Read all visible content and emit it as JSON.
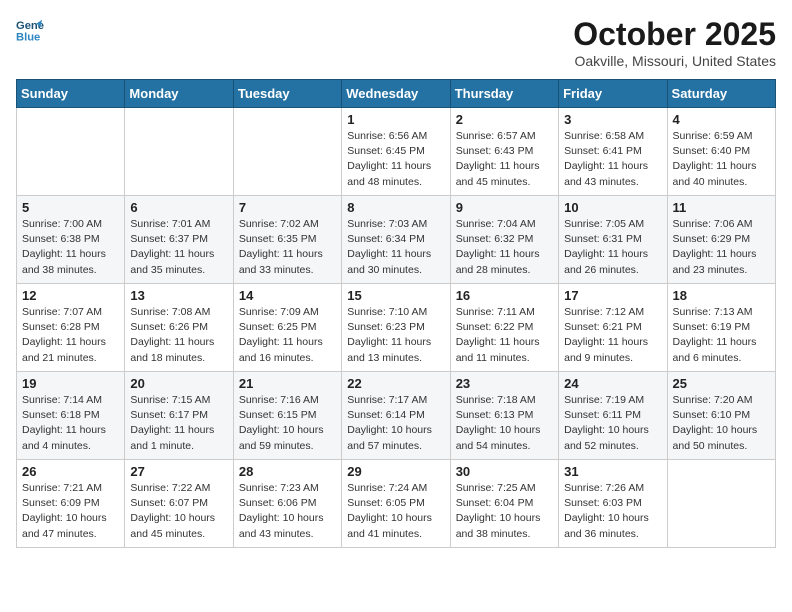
{
  "header": {
    "logo_line1": "General",
    "logo_line2": "Blue",
    "title": "October 2025",
    "subtitle": "Oakville, Missouri, United States"
  },
  "weekdays": [
    "Sunday",
    "Monday",
    "Tuesday",
    "Wednesday",
    "Thursday",
    "Friday",
    "Saturday"
  ],
  "weeks": [
    [
      {
        "day": "",
        "info": ""
      },
      {
        "day": "",
        "info": ""
      },
      {
        "day": "",
        "info": ""
      },
      {
        "day": "1",
        "info": "Sunrise: 6:56 AM\nSunset: 6:45 PM\nDaylight: 11 hours and 48 minutes."
      },
      {
        "day": "2",
        "info": "Sunrise: 6:57 AM\nSunset: 6:43 PM\nDaylight: 11 hours and 45 minutes."
      },
      {
        "day": "3",
        "info": "Sunrise: 6:58 AM\nSunset: 6:41 PM\nDaylight: 11 hours and 43 minutes."
      },
      {
        "day": "4",
        "info": "Sunrise: 6:59 AM\nSunset: 6:40 PM\nDaylight: 11 hours and 40 minutes."
      }
    ],
    [
      {
        "day": "5",
        "info": "Sunrise: 7:00 AM\nSunset: 6:38 PM\nDaylight: 11 hours and 38 minutes."
      },
      {
        "day": "6",
        "info": "Sunrise: 7:01 AM\nSunset: 6:37 PM\nDaylight: 11 hours and 35 minutes."
      },
      {
        "day": "7",
        "info": "Sunrise: 7:02 AM\nSunset: 6:35 PM\nDaylight: 11 hours and 33 minutes."
      },
      {
        "day": "8",
        "info": "Sunrise: 7:03 AM\nSunset: 6:34 PM\nDaylight: 11 hours and 30 minutes."
      },
      {
        "day": "9",
        "info": "Sunrise: 7:04 AM\nSunset: 6:32 PM\nDaylight: 11 hours and 28 minutes."
      },
      {
        "day": "10",
        "info": "Sunrise: 7:05 AM\nSunset: 6:31 PM\nDaylight: 11 hours and 26 minutes."
      },
      {
        "day": "11",
        "info": "Sunrise: 7:06 AM\nSunset: 6:29 PM\nDaylight: 11 hours and 23 minutes."
      }
    ],
    [
      {
        "day": "12",
        "info": "Sunrise: 7:07 AM\nSunset: 6:28 PM\nDaylight: 11 hours and 21 minutes."
      },
      {
        "day": "13",
        "info": "Sunrise: 7:08 AM\nSunset: 6:26 PM\nDaylight: 11 hours and 18 minutes."
      },
      {
        "day": "14",
        "info": "Sunrise: 7:09 AM\nSunset: 6:25 PM\nDaylight: 11 hours and 16 minutes."
      },
      {
        "day": "15",
        "info": "Sunrise: 7:10 AM\nSunset: 6:23 PM\nDaylight: 11 hours and 13 minutes."
      },
      {
        "day": "16",
        "info": "Sunrise: 7:11 AM\nSunset: 6:22 PM\nDaylight: 11 hours and 11 minutes."
      },
      {
        "day": "17",
        "info": "Sunrise: 7:12 AM\nSunset: 6:21 PM\nDaylight: 11 hours and 9 minutes."
      },
      {
        "day": "18",
        "info": "Sunrise: 7:13 AM\nSunset: 6:19 PM\nDaylight: 11 hours and 6 minutes."
      }
    ],
    [
      {
        "day": "19",
        "info": "Sunrise: 7:14 AM\nSunset: 6:18 PM\nDaylight: 11 hours and 4 minutes."
      },
      {
        "day": "20",
        "info": "Sunrise: 7:15 AM\nSunset: 6:17 PM\nDaylight: 11 hours and 1 minute."
      },
      {
        "day": "21",
        "info": "Sunrise: 7:16 AM\nSunset: 6:15 PM\nDaylight: 10 hours and 59 minutes."
      },
      {
        "day": "22",
        "info": "Sunrise: 7:17 AM\nSunset: 6:14 PM\nDaylight: 10 hours and 57 minutes."
      },
      {
        "day": "23",
        "info": "Sunrise: 7:18 AM\nSunset: 6:13 PM\nDaylight: 10 hours and 54 minutes."
      },
      {
        "day": "24",
        "info": "Sunrise: 7:19 AM\nSunset: 6:11 PM\nDaylight: 10 hours and 52 minutes."
      },
      {
        "day": "25",
        "info": "Sunrise: 7:20 AM\nSunset: 6:10 PM\nDaylight: 10 hours and 50 minutes."
      }
    ],
    [
      {
        "day": "26",
        "info": "Sunrise: 7:21 AM\nSunset: 6:09 PM\nDaylight: 10 hours and 47 minutes."
      },
      {
        "day": "27",
        "info": "Sunrise: 7:22 AM\nSunset: 6:07 PM\nDaylight: 10 hours and 45 minutes."
      },
      {
        "day": "28",
        "info": "Sunrise: 7:23 AM\nSunset: 6:06 PM\nDaylight: 10 hours and 43 minutes."
      },
      {
        "day": "29",
        "info": "Sunrise: 7:24 AM\nSunset: 6:05 PM\nDaylight: 10 hours and 41 minutes."
      },
      {
        "day": "30",
        "info": "Sunrise: 7:25 AM\nSunset: 6:04 PM\nDaylight: 10 hours and 38 minutes."
      },
      {
        "day": "31",
        "info": "Sunrise: 7:26 AM\nSunset: 6:03 PM\nDaylight: 10 hours and 36 minutes."
      },
      {
        "day": "",
        "info": ""
      }
    ]
  ]
}
